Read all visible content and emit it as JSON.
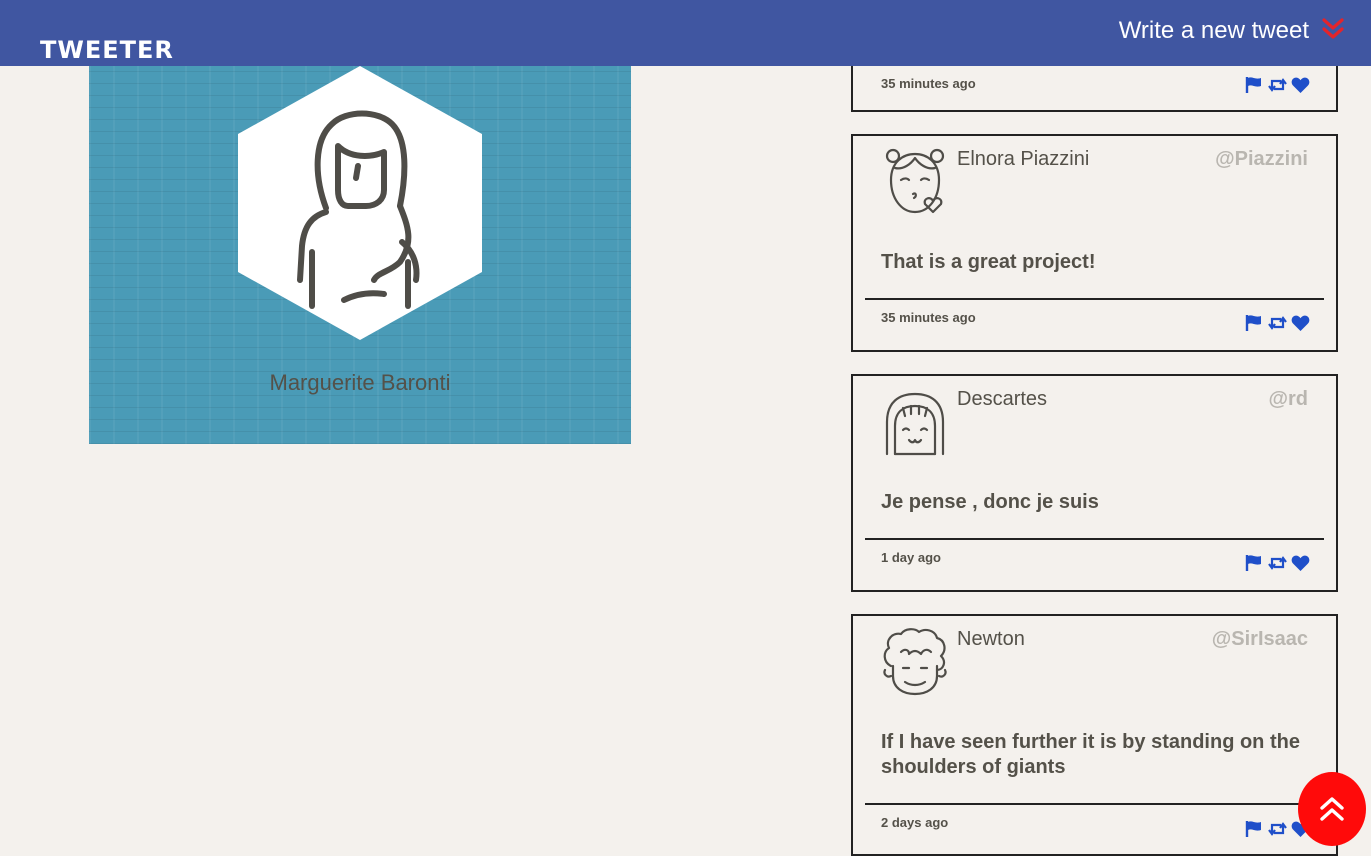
{
  "nav": {
    "brand": "Tweeter",
    "compose_label": "Write a new tweet"
  },
  "profile": {
    "name": "Marguerite Baronti"
  },
  "tweets": [
    {
      "name": "",
      "handle": "",
      "text": "",
      "time": "35 minutes ago"
    },
    {
      "name": "Elnora Piazzini",
      "handle": "@Piazzini",
      "text": "That is a great project!",
      "time": "35 minutes ago"
    },
    {
      "name": "Descartes",
      "handle": "@rd",
      "text": "Je pense , donc je suis",
      "time": "1 day ago"
    },
    {
      "name": "Newton",
      "handle": "@SirIsaac",
      "text": "If I have seen further it is by standing on the shoulders of giants",
      "time": "2 days ago"
    }
  ],
  "icons": {
    "compose": "double-chevron-down-icon",
    "flag": "flag-icon",
    "retweet": "retweet-icon",
    "like": "heart-icon",
    "scroll_top": "double-chevron-up-icon"
  },
  "colors": {
    "nav_bg": "#4056a1",
    "page_bg": "#f4f1ed",
    "profile_bg": "#4a9bb7",
    "action_icon": "#1f4fc9",
    "accent_red": "#ff0a0a"
  }
}
